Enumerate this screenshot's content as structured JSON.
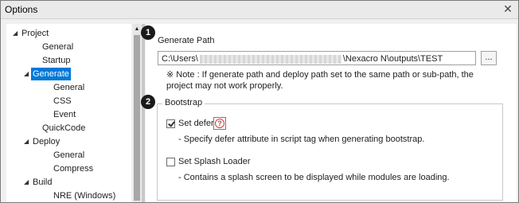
{
  "window": {
    "title": "Options",
    "close_glyph": "✕"
  },
  "tree": {
    "items": [
      {
        "label": "Project",
        "arrow": "◢"
      },
      {
        "label": "General",
        "arrow": ""
      },
      {
        "label": "Startup",
        "arrow": ""
      },
      {
        "label": "Generate",
        "arrow": "◢"
      },
      {
        "label": "General",
        "arrow": ""
      },
      {
        "label": "CSS",
        "arrow": ""
      },
      {
        "label": "Event",
        "arrow": ""
      },
      {
        "label": "QuickCode",
        "arrow": ""
      },
      {
        "label": "Deploy",
        "arrow": "◢"
      },
      {
        "label": "General",
        "arrow": ""
      },
      {
        "label": "Compress",
        "arrow": ""
      },
      {
        "label": "Build",
        "arrow": "◢"
      },
      {
        "label": "NRE (Windows)",
        "arrow": ""
      }
    ],
    "selected_color": "#0078d7"
  },
  "scroll": {
    "up_glyph": "▲"
  },
  "generate_path": {
    "badge": "1",
    "title": "Generate Path",
    "path_prefix": "C:\\Users\\",
    "path_suffix": "\\Nexacro N\\outputs\\TEST",
    "browse_label": "...",
    "note": "※ Note : If generate path and deploy path set to the same path or sub-path, the project may not work properly."
  },
  "bootstrap": {
    "badge": "2",
    "title": "Bootstrap",
    "set_defer_label": "Set defer",
    "set_defer_checked": true,
    "help_glyph": "?",
    "set_defer_desc": "- Specify defer attribute in script tag when generating bootstrap.",
    "splash_label": "Set Splash Loader",
    "splash_checked": false,
    "splash_desc": "- Contains a splash screen to be displayed while modules are loading."
  }
}
